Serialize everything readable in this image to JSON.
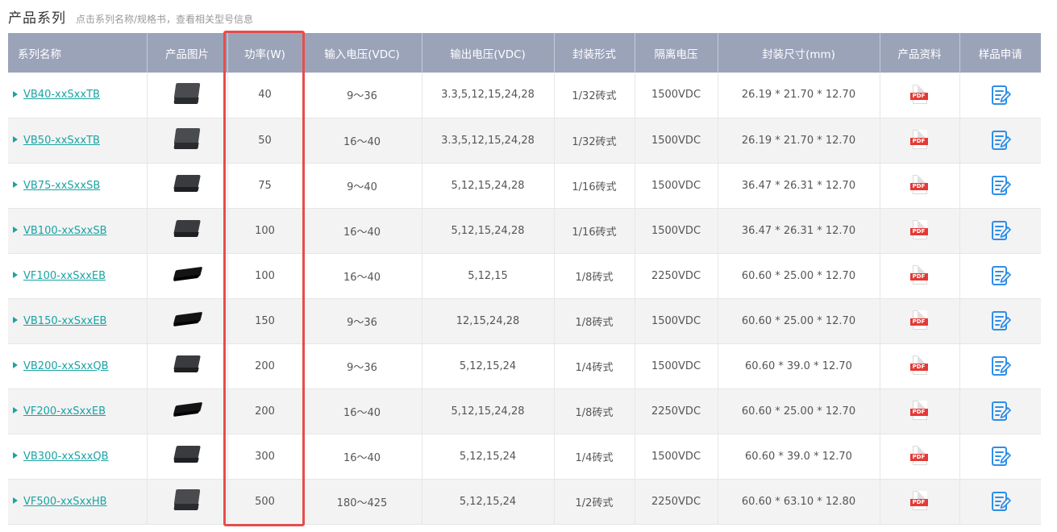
{
  "header": {
    "title": "产品系列",
    "hint": "点击系列名称/规格书，查看相关型号信息"
  },
  "table": {
    "columns": [
      "系列名称",
      "产品图片",
      "功率(W)",
      "输入电压(VDC)",
      "输出电压(VDC)",
      "封装形式",
      "隔离电压",
      "封装尺寸(mm)",
      "产品资料",
      "样品申请"
    ],
    "pdf_label": "PDF",
    "rows": [
      {
        "name": "VB40-xxSxxTB",
        "image": "module-tall",
        "power": "40",
        "input": "9～36",
        "output": "3.3,5,12,15,24,28",
        "package": "1/32砖式",
        "isolation": "1500VDC",
        "size": "26.19 * 21.70 * 12.70"
      },
      {
        "name": "VB50-xxSxxTB",
        "image": "module-tall",
        "power": "50",
        "input": "16～40",
        "output": "3.3,5,12,15,24,28",
        "package": "1/32砖式",
        "isolation": "1500VDC",
        "size": "26.19 * 21.70 * 12.70"
      },
      {
        "name": "VB75-xxSxxSB",
        "image": "module",
        "power": "75",
        "input": "9～40",
        "output": "5,12,15,24,28",
        "package": "1/16砖式",
        "isolation": "1500VDC",
        "size": "36.47 * 26.31 * 12.70"
      },
      {
        "name": "VB100-xxSxxSB",
        "image": "module",
        "power": "100",
        "input": "16～40",
        "output": "5,12,15,24,28",
        "package": "1/16砖式",
        "isolation": "1500VDC",
        "size": "36.47 * 26.31 * 12.70"
      },
      {
        "name": "VF100-xxSxxEB",
        "image": "module-flat",
        "power": "100",
        "input": "16～40",
        "output": "5,12,15",
        "package": "1/8砖式",
        "isolation": "2250VDC",
        "size": "60.60 * 25.00 * 12.70"
      },
      {
        "name": "VB150-xxSxxEB",
        "image": "module-flat",
        "power": "150",
        "input": "9～36",
        "output": "12,15,24,28",
        "package": "1/8砖式",
        "isolation": "1500VDC",
        "size": "60.60 * 25.00 * 12.70"
      },
      {
        "name": "VB200-xxSxxQB",
        "image": "module",
        "power": "200",
        "input": "9～36",
        "output": "5,12,15,24",
        "package": "1/4砖式",
        "isolation": "1500VDC",
        "size": "60.60 * 39.0 * 12.70"
      },
      {
        "name": "VF200-xxSxxEB",
        "image": "module-flat",
        "power": "200",
        "input": "16～40",
        "output": "5,12,15,24,28",
        "package": "1/8砖式",
        "isolation": "2250VDC",
        "size": "60.60 * 25.00 * 12.70"
      },
      {
        "name": "VB300-xxSxxQB",
        "image": "module",
        "power": "300",
        "input": "16～40",
        "output": "5,12,15,24",
        "package": "1/4砖式",
        "isolation": "1500VDC",
        "size": "60.60 * 39.0 * 12.70"
      },
      {
        "name": "VF500-xxSxxHB",
        "image": "module-tall",
        "power": "500",
        "input": "180～425",
        "output": "5,12,15,24",
        "package": "1/2砖式",
        "isolation": "2250VDC",
        "size": "60.60 * 63.10 * 12.80"
      }
    ]
  },
  "colors": {
    "header_bg": "#9ba3b9",
    "link": "#1aa3a3",
    "highlight": "#e74c4c",
    "pdf_red": "#e53935",
    "apply_blue": "#2f8ee8"
  },
  "icons": {
    "pdf": "pdf-icon",
    "apply": "edit-document-icon",
    "row_marker": "triangle-right-icon"
  }
}
